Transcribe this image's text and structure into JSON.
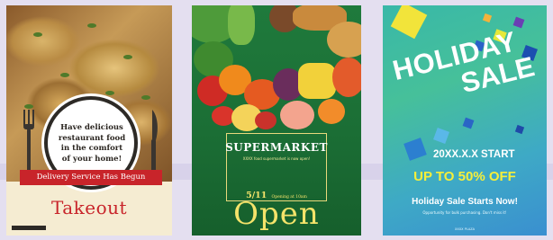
{
  "posters": [
    {
      "plate_text_lines": [
        "Have delicious",
        "restaurant food",
        "in the comfort",
        "of your home!"
      ],
      "ribbon": "Delivery Service Has Begun",
      "title": "Takeout",
      "colors": {
        "accent": "#c8242a",
        "background": "#f5ecd2"
      }
    },
    {
      "title": "SUPERMARKET",
      "subtitle": "XXXX food supermarket is now open!",
      "date": "5/11",
      "time_text": "Opening at 10am",
      "headline": "Open",
      "colors": {
        "accent": "#f4e36a",
        "background": "#1f7a3c"
      }
    },
    {
      "holiday": "HOLIDAY",
      "sale": "SALE",
      "date_text": "20XX.X.X START",
      "discount": "UP TO 50% OFF",
      "starts": "Holiday Sale Starts Now!",
      "note": "Opportunity for bulk purchasing. Don't miss it!",
      "venue": "XXXX PLAZA",
      "colors": {
        "highlight": "#f6ef3a",
        "background": "#3ea9c6"
      }
    }
  ]
}
